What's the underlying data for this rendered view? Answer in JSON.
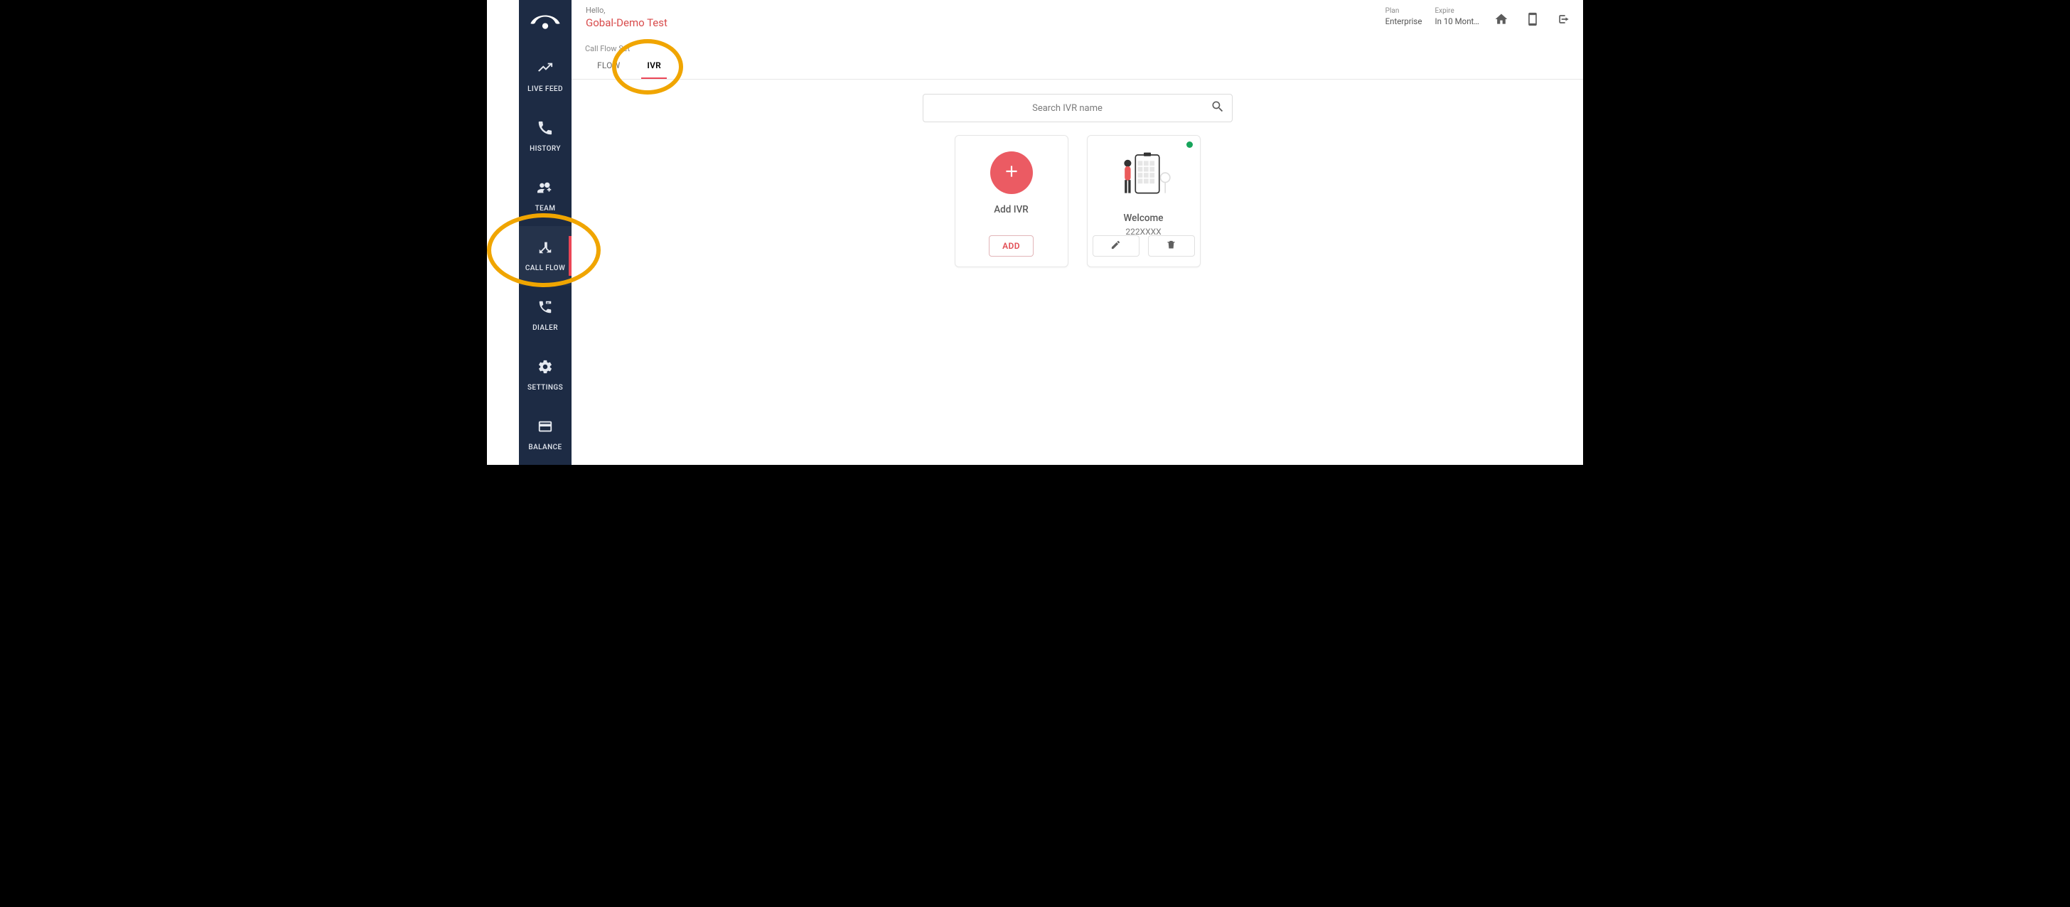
{
  "header": {
    "hello": "Hello,",
    "user_name": "Gobal-Demo Test",
    "plan_label": "Plan",
    "plan_value": "Enterprise",
    "expire_label": "Expire",
    "expire_value": "In 10 Mont…"
  },
  "sidebar": {
    "items": [
      {
        "id": "live-feed",
        "label": "LIVE FEED"
      },
      {
        "id": "history",
        "label": "HISTORY"
      },
      {
        "id": "team",
        "label": "TEAM"
      },
      {
        "id": "call-flow",
        "label": "CALL FLOW",
        "active": true
      },
      {
        "id": "dialer",
        "label": "DIALER"
      },
      {
        "id": "settings",
        "label": "SETTINGS"
      },
      {
        "id": "balance",
        "label": "BALANCE"
      }
    ]
  },
  "breadcrumb": "Call Flow Set",
  "tabs": [
    {
      "id": "flow",
      "label": "FLOW"
    },
    {
      "id": "ivr",
      "label": "IVR",
      "active": true
    }
  ],
  "search": {
    "placeholder": "Search IVR name"
  },
  "add_card": {
    "title": "Add IVR",
    "button": "ADD"
  },
  "ivr_card": {
    "title": "Welcome",
    "number": "222XXXX",
    "status": "active"
  }
}
